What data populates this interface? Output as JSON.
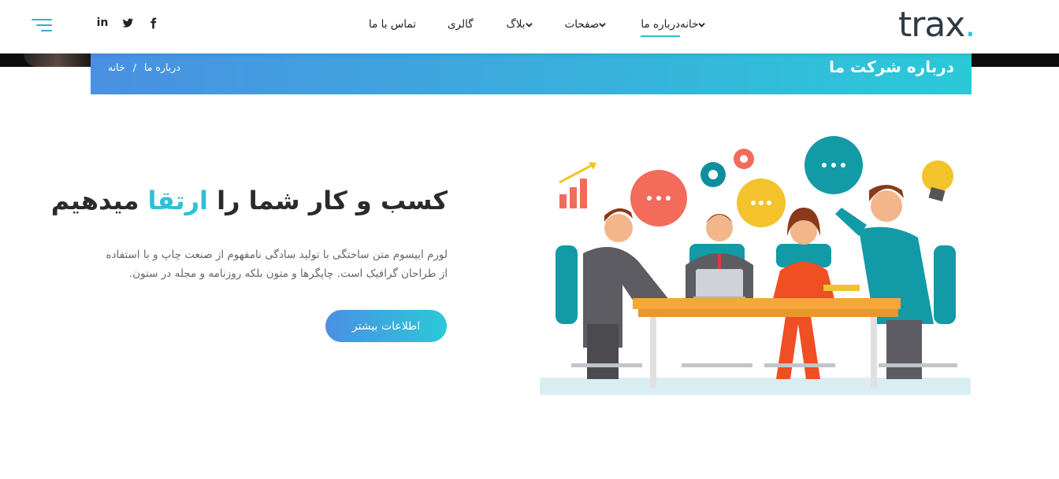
{
  "header": {
    "logo_text": "trax",
    "logo_dot": ".",
    "nav": [
      {
        "label": "خانه",
        "has_dropdown": true
      },
      {
        "label": "درباره ما",
        "active": true
      },
      {
        "label": "صفحات",
        "has_dropdown": true
      },
      {
        "label": "بلاگ",
        "has_dropdown": true
      },
      {
        "label": "گالری"
      },
      {
        "label": "تماس با ما"
      }
    ],
    "social_icons": [
      "facebook-icon",
      "twitter-icon",
      "linkedin-icon"
    ],
    "linkedin_text": "in",
    "menu_icon": "hamburger-menu-icon"
  },
  "breadcrumb": {
    "title": "درباره شرکت ما",
    "home": "خانه",
    "separator": "/",
    "current": "درباره ما"
  },
  "hero": {
    "headline_before": "کسب و کار شما را ",
    "headline_accent": "ارتقا",
    "headline_after": " میدهیم",
    "paragraph": "لورم ایپسوم متن ساختگی با تولید سادگی نامفهوم از صنعت چاپ و با استفاده از طراحان گرافیک است. چاپگرها و متون بلکه روزنامه و مجله در ستون.",
    "cta_label": "اطلاعات بیشتر"
  },
  "colors": {
    "accent": "#2ec1d6",
    "gradient_start": "#4a90e2",
    "gradient_end": "#2bc9d8",
    "text_dark": "#2b2b2b"
  }
}
